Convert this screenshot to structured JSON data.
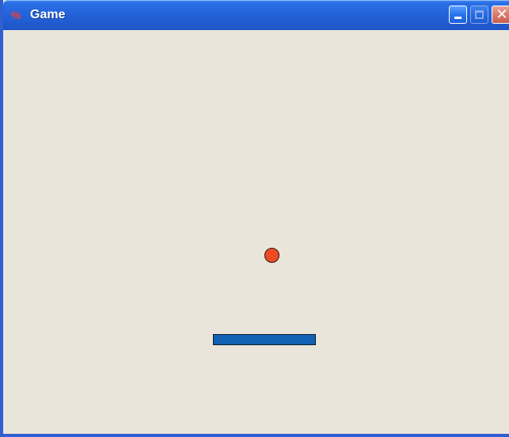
{
  "window": {
    "title": "Game",
    "icon": "app-icon",
    "controls": {
      "minimize": "minimize-icon",
      "maximize": "maximize-icon",
      "close": "close-icon"
    },
    "colors": {
      "titlebar": "#2260d7",
      "client_background": "#e9e5da"
    }
  },
  "game": {
    "ball": {
      "color": "#ee4b24"
    },
    "paddle": {
      "color": "#1060b4"
    }
  }
}
